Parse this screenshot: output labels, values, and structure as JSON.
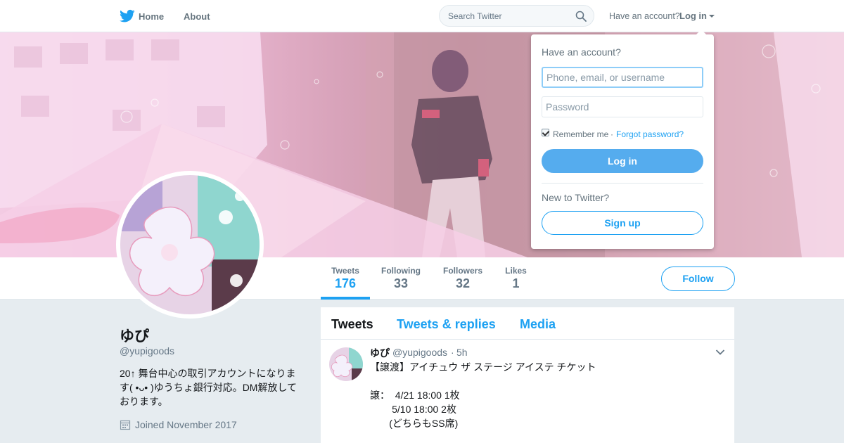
{
  "nav": {
    "home": "Home",
    "about": "About",
    "search_placeholder": "Search Twitter",
    "have_account": "Have an account?",
    "login": "Log in"
  },
  "login_dropdown": {
    "title": "Have an account?",
    "username_placeholder": "Phone, email, or username",
    "password_placeholder": "Password",
    "remember_me": "Remember me",
    "separator": "·",
    "forgot_password": "Forgot password?",
    "login_button": "Log in",
    "new_to_twitter": "New to Twitter?",
    "signup_button": "Sign up",
    "remember_checked": true
  },
  "stats": [
    {
      "label": "Tweets",
      "value": "176",
      "active": true
    },
    {
      "label": "Following",
      "value": "33",
      "active": false
    },
    {
      "label": "Followers",
      "value": "32",
      "active": false
    },
    {
      "label": "Likes",
      "value": "1",
      "active": false
    }
  ],
  "follow_button": "Follow",
  "profile": {
    "name": "ゆぴ",
    "handle": "@yupigoods",
    "bio": "20↑ 舞台中心の取引アカウントになります( •ᴗ• )ゆうちょ銀行対応。DM解放しております。",
    "joined": "Joined November 2017"
  },
  "timeline": {
    "tabs": [
      "Tweets",
      "Tweets & replies",
      "Media"
    ],
    "tweet": {
      "name": "ゆぴ",
      "handle": "@yupigoods",
      "separator": "·",
      "time": "5h",
      "text": "【譲渡】アイチュウ ザ ステージ アイステ チケット\n\n譲：  4/21 18:00 1枚\n        5/10 18:00 2枚\n       (どちらもSS席)"
    }
  },
  "colors": {
    "accent": "#1da1f2",
    "login_button": "#55acee",
    "banner_pink": "#f3cbe3"
  },
  "icons": [
    "twitter-bird-icon",
    "search-icon",
    "caret-down-icon",
    "calendar-icon",
    "chevron-down-icon"
  ]
}
